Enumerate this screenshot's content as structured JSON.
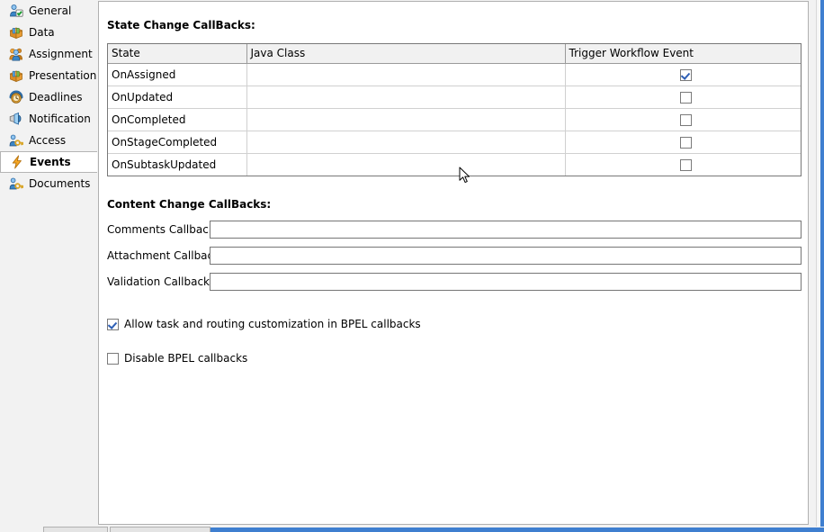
{
  "sidebar": {
    "items": [
      {
        "label": "General",
        "icon": "user-check-icon",
        "selected": false
      },
      {
        "label": "Data",
        "icon": "data-box-icon",
        "selected": false
      },
      {
        "label": "Assignment",
        "icon": "users-group-icon",
        "selected": false
      },
      {
        "label": "Presentation",
        "icon": "presentation-box-icon",
        "selected": false
      },
      {
        "label": "Deadlines",
        "icon": "clock-icon",
        "selected": false
      },
      {
        "label": "Notification",
        "icon": "megaphone-icon",
        "selected": false
      },
      {
        "label": "Access",
        "icon": "user-key-icon",
        "selected": false
      },
      {
        "label": "Events",
        "icon": "lightning-bolt-icon",
        "selected": true
      },
      {
        "label": "Documents",
        "icon": "user-key-icon",
        "selected": false
      }
    ]
  },
  "main": {
    "state_section_title": "State Change CallBacks:",
    "content_section_title": "Content Change CallBacks:",
    "table": {
      "columns": [
        "State",
        "Java Class",
        "Trigger Workflow Event"
      ],
      "rows": [
        {
          "state": "OnAssigned",
          "java_class": "",
          "trigger": true
        },
        {
          "state": "OnUpdated",
          "java_class": "",
          "trigger": false
        },
        {
          "state": "OnCompleted",
          "java_class": "",
          "trigger": false
        },
        {
          "state": "OnStageCompleted",
          "java_class": "",
          "trigger": false
        },
        {
          "state": "OnSubtaskUpdated",
          "java_class": "",
          "trigger": false
        }
      ]
    },
    "fields": [
      {
        "label": "Comments Callback:",
        "value": "",
        "placeholder": ""
      },
      {
        "label": "Attachment Callback:",
        "value": "",
        "placeholder": ""
      },
      {
        "label": "Validation Callback:",
        "value": "",
        "placeholder": ""
      }
    ],
    "options": [
      {
        "label": "Allow task and routing customization in BPEL callbacks",
        "checked": true
      },
      {
        "label": "Disable BPEL callbacks",
        "checked": false
      }
    ]
  },
  "colors": {
    "accent_blue": "#3f7fd0",
    "check_blue": "#2e5fb5",
    "panel_bg": "#ffffff",
    "window_bg": "#f2f2f2",
    "header_bg": "#f1f1f1",
    "border_gray": "#787878"
  }
}
